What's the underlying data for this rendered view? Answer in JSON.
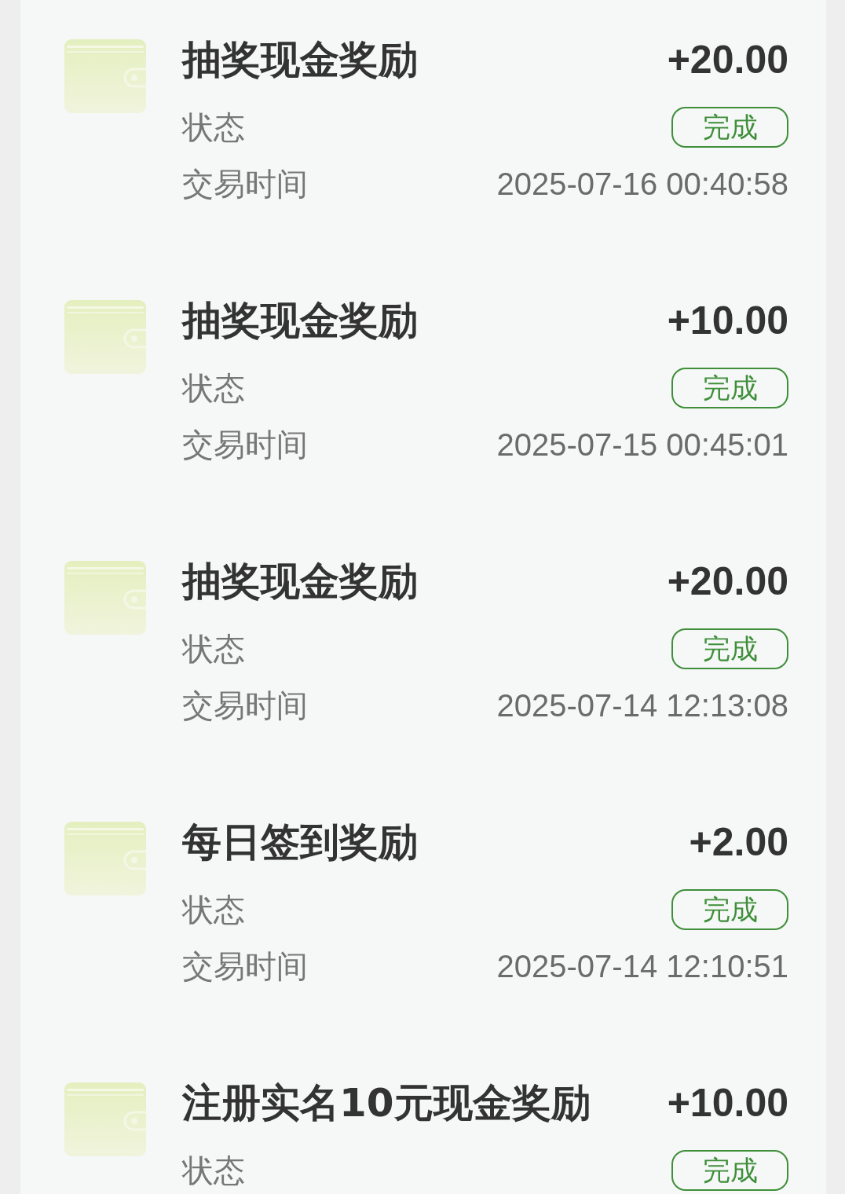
{
  "transactions": [
    {
      "title": "抽奖现金奖励",
      "amount": "+20.00",
      "status_label": "状态",
      "status": "完成",
      "time_label": "交易时间",
      "time": "2025-07-16 00:40:58"
    },
    {
      "title": "抽奖现金奖励",
      "amount": "+10.00",
      "status_label": "状态",
      "status": "完成",
      "time_label": "交易时间",
      "time": "2025-07-15 00:45:01"
    },
    {
      "title": "抽奖现金奖励",
      "amount": "+20.00",
      "status_label": "状态",
      "status": "完成",
      "time_label": "交易时间",
      "time": "2025-07-14 12:13:08"
    },
    {
      "title": "每日签到奖励",
      "amount": "+2.00",
      "status_label": "状态",
      "status": "完成",
      "time_label": "交易时间",
      "time": "2025-07-14 12:10:51"
    },
    {
      "title": "注册实名10元现金奖励",
      "amount": "+10.00",
      "status_label": "状态",
      "status": "完成"
    }
  ]
}
